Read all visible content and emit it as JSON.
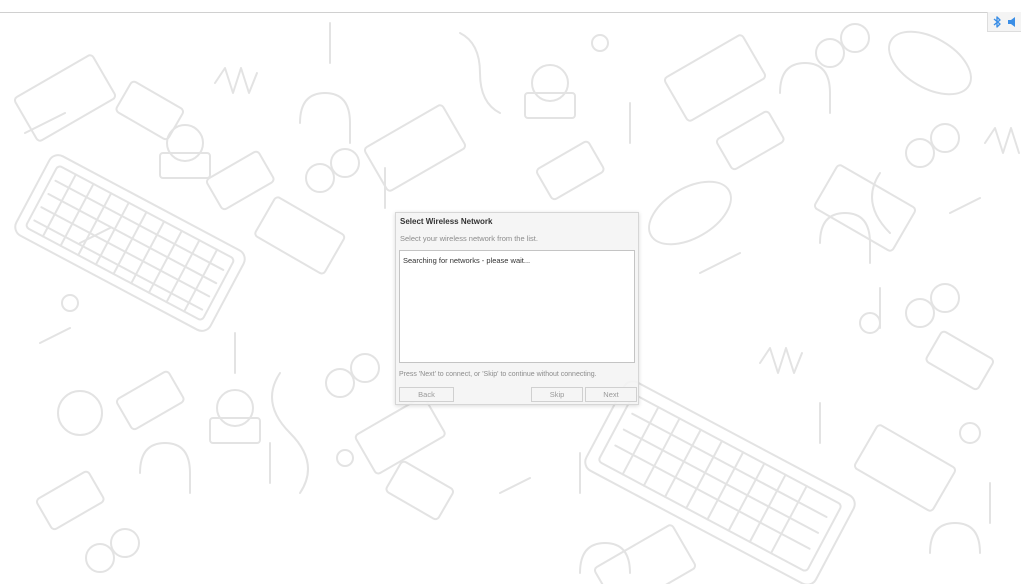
{
  "dialog": {
    "title": "Select Wireless Network",
    "instructions": "Select your wireless network from the list.",
    "list_status": "Searching for networks - please wait...",
    "footer": "Press 'Next' to connect, or 'Skip' to continue without connecting.",
    "buttons": {
      "back": "Back",
      "skip": "Skip",
      "next": "Next"
    }
  },
  "tray": {
    "icons": [
      "bluetooth-icon",
      "volume-icon"
    ],
    "accent_color": "#3a8ee6"
  },
  "wallpaper": {
    "line_color": "#e3e3e3"
  }
}
